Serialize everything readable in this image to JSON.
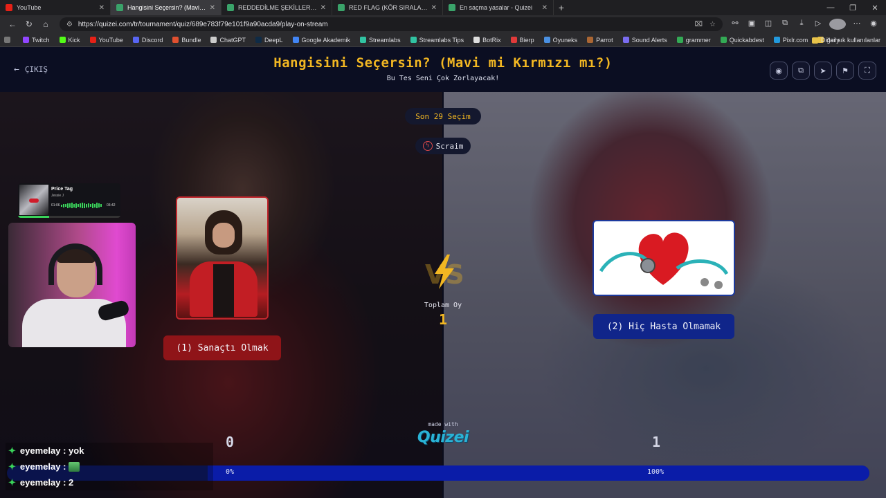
{
  "browser": {
    "tabs": [
      {
        "title": "YouTube",
        "color": "#e62117",
        "active": false
      },
      {
        "title": "Hangisini Seçersin? (Mavi mi Kırmızı",
        "color": "#3aa36a",
        "active": true
      },
      {
        "title": "REDDEDİLME ŞEKİLLERİ (KÖR SIRA",
        "color": "#3aa36a",
        "active": false
      },
      {
        "title": "RED FLAG (KÖR SIRALAMA) PARTİ",
        "color": "#3aa36a",
        "active": false
      },
      {
        "title": "En saçma yasalar - Quizei",
        "color": "#3aa36a",
        "active": false
      }
    ],
    "url": "https://quizei.com/tr/tournament/quiz/689e783f79e101f9a90acda9/play-on-stream",
    "bookmarks": [
      {
        "label": "Twitch",
        "color": "#9146ff"
      },
      {
        "label": "Kick",
        "color": "#53fc18"
      },
      {
        "label": "YouTube",
        "color": "#e62117"
      },
      {
        "label": "Discord",
        "color": "#5865f2"
      },
      {
        "label": "Bundle",
        "color": "#e05030"
      },
      {
        "label": "ChatGPT",
        "color": "#cccccc"
      },
      {
        "label": "DeepL",
        "color": "#0f2b46"
      },
      {
        "label": "Google Akademik",
        "color": "#4285f4"
      },
      {
        "label": "Streamlabs",
        "color": "#31c3a2"
      },
      {
        "label": "Streamlabs Tips",
        "color": "#31c3a2"
      },
      {
        "label": "BotRix",
        "color": "#dddddd"
      },
      {
        "label": "Bierp",
        "color": "#e03a3a"
      },
      {
        "label": "Oyuneks",
        "color": "#4a90e2"
      },
      {
        "label": "Parrot",
        "color": "#aa6633"
      },
      {
        "label": "Sound Alerts",
        "color": "#7a6cf0"
      },
      {
        "label": "grammer",
        "color": "#33aa55"
      },
      {
        "label": "Quickabdest",
        "color": "#33aa55"
      },
      {
        "label": "Pixlr.com",
        "color": "#2299dd"
      },
      {
        "label": "daily",
        "color": "#e8c34a"
      }
    ],
    "other_bookmarks": "Diğer sık kullanılanlar"
  },
  "header": {
    "exit_label": "ÇIKIŞ",
    "title": "Hangisini Seçersin? (Mavi mi Kırmızı mı?)",
    "subtitle": "Bu Tes Seni Çok Zorlayacak!"
  },
  "status": {
    "round": "Son 29 Seçim",
    "streamer": "Scraim"
  },
  "options": [
    {
      "label": "(1) Sanaçtı Olmak",
      "votes": "0",
      "percent": "0%",
      "color": "#8f1418"
    },
    {
      "label": "(2) Hiç Hasta Olmamak",
      "votes": "1",
      "percent": "100%",
      "color": "#10258a"
    }
  ],
  "total": {
    "label": "Toplam Oy",
    "value": "1"
  },
  "progress_fraction": 1.0,
  "branding": {
    "made_with": "made with",
    "logo": "Quizei"
  },
  "overlay": {
    "music": {
      "song": "Price Tag",
      "artist": "Jessie J",
      "elapsed": "01:06",
      "duration": "03:42"
    },
    "chat": [
      {
        "user": "eyemelay",
        "message": "yok",
        "emote": false
      },
      {
        "user": "eyemelay",
        "message": "",
        "emote": true
      },
      {
        "user": "eyemelay",
        "message": "2",
        "emote": false
      }
    ]
  }
}
